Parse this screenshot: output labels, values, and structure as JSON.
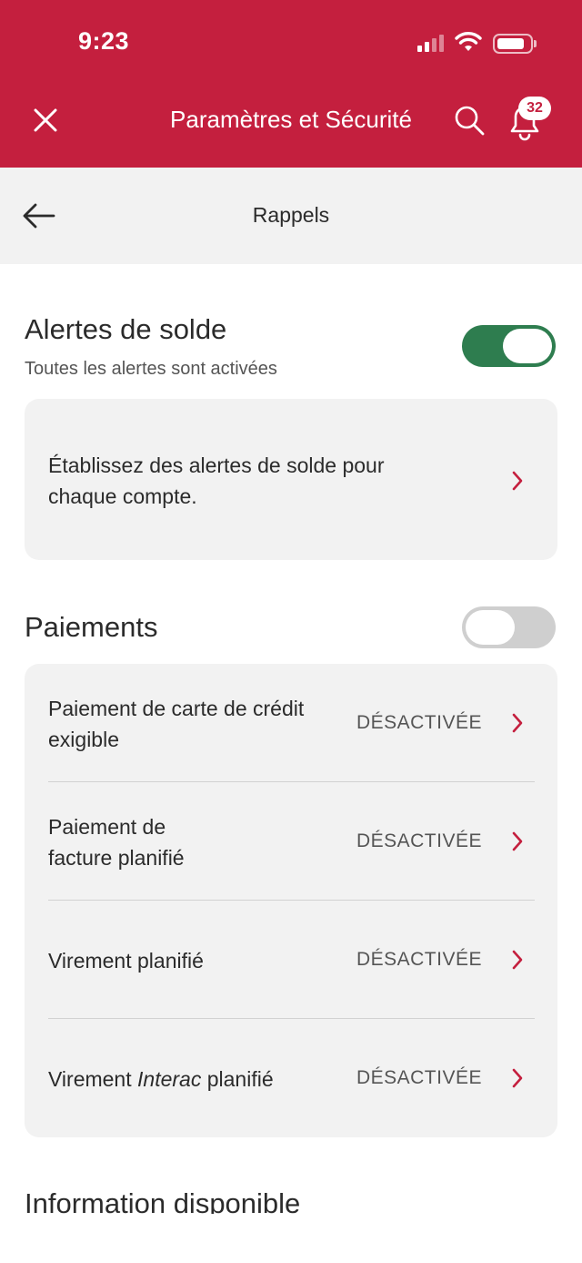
{
  "status_bar": {
    "time": "9:23"
  },
  "header": {
    "title": "Paramètres et Sécurité",
    "notification_count": "32",
    "close_icon": "close-icon",
    "search_icon": "search-icon",
    "bell_icon": "bell-icon"
  },
  "subheader": {
    "title": "Rappels",
    "back_icon": "arrow-left-icon"
  },
  "balance_alerts": {
    "title": "Alertes de solde",
    "subtitle": "Toutes les alertes sont activées",
    "enabled": true,
    "card_text": "Établissez des alertes de solde pour chaque compte."
  },
  "payments": {
    "title": "Paiements",
    "enabled": false,
    "rows": [
      {
        "label": "Paiement de carte de crédit exigible",
        "status": "DÉSACTIVÉE"
      },
      {
        "label": "Paiement de facture planifié",
        "status": "DÉSACTIVÉE"
      },
      {
        "label": "Virement planifié",
        "status": "DÉSACTIVÉE"
      },
      {
        "label_prefix": "Virement ",
        "label_italic": "Interac",
        "label_suffix": " planifié",
        "status": "DÉSACTIVÉE"
      }
    ]
  },
  "next_section": {
    "title": "Information disponible"
  },
  "colors": {
    "brand": "#c41f3e",
    "toggle_on": "#2e7d4f",
    "toggle_off": "#cfcfcf",
    "card_bg": "#f2f2f2"
  }
}
